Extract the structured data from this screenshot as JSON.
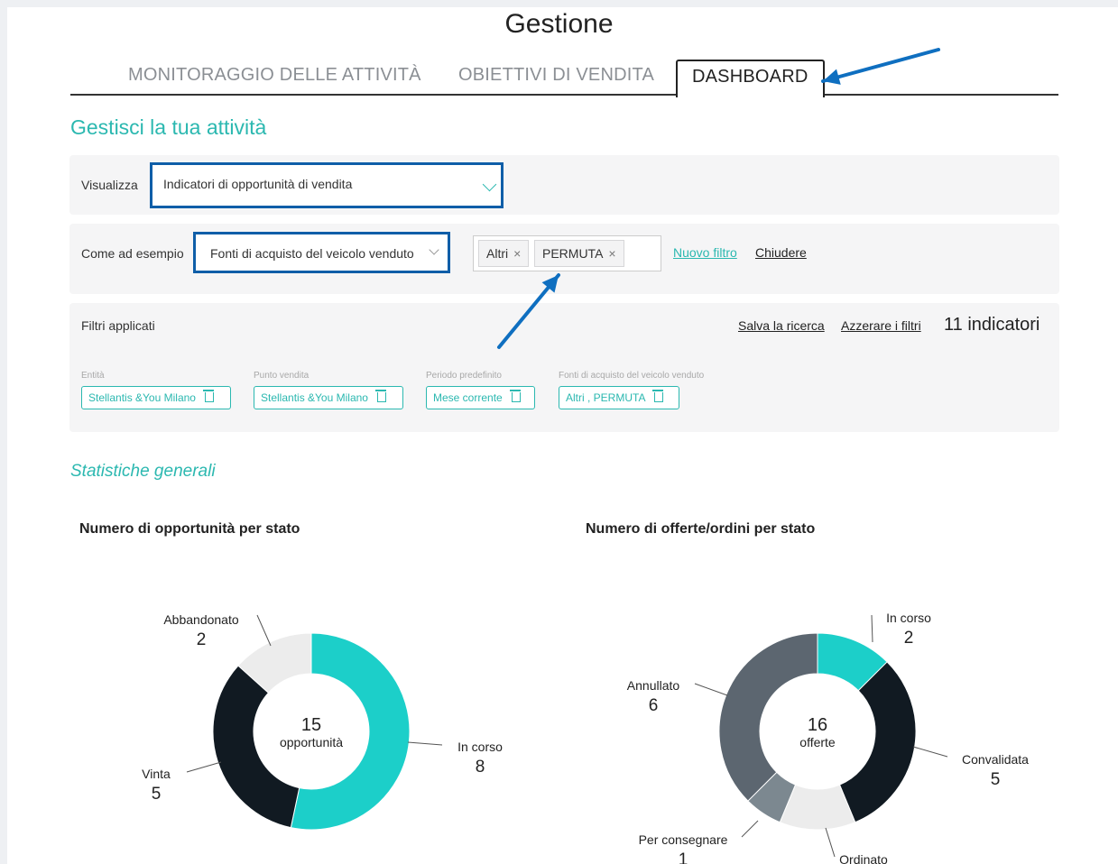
{
  "header": {
    "title": "Gestione"
  },
  "tabs": [
    {
      "label": "MONITORAGGIO DELLE ATTIVITÀ",
      "active": false
    },
    {
      "label": "OBIETTIVI DI VENDITA",
      "active": false
    },
    {
      "label": "DASHBOARD",
      "active": true
    }
  ],
  "section_title": "Gestisci la tua attività",
  "view": {
    "label": "Visualizza",
    "selected": "Indicatori di opportunità di vendita"
  },
  "filter": {
    "label": "Come ad esempio",
    "selected": "Fonti di acquisto del veicolo venduto",
    "chips": [
      "Altri",
      "PERMUTA"
    ],
    "chip_remove": "×",
    "new_filter": "Nuovo filtro",
    "close": "Chiudere"
  },
  "applied": {
    "label": "Filtri applicati",
    "save": "Salva la ricerca",
    "reset": "Azzerare i filtri",
    "count": "11 indicatori",
    "filters": [
      {
        "name": "Entità",
        "value": "Stellantis &You Milano"
      },
      {
        "name": "Punto vendita",
        "value": "Stellantis &You Milano"
      },
      {
        "name": "Periodo predefinito",
        "value": "Mese corrente"
      },
      {
        "name": "Fonti di acquisto del veicolo venduto",
        "value": "Altri , PERMUTA"
      }
    ]
  },
  "stats_title": "Statistiche generali",
  "chart_data": [
    {
      "type": "pie",
      "title": "Numero di opportunità per stato",
      "center_value": "15",
      "center_label": "opportunità",
      "categories": [
        "In corso",
        "Vinta",
        "Abbandonato"
      ],
      "values": [
        8,
        5,
        2
      ],
      "colors": [
        "#1ccfc9",
        "#111a22",
        "#ececec"
      ]
    },
    {
      "type": "pie",
      "title": "Numero di offerte/ordini per stato",
      "center_value": "16",
      "center_label": "offerte",
      "categories": [
        "In corso",
        "Convalidata",
        "Ordinato",
        "Per consegnare",
        "Annullato"
      ],
      "values": [
        2,
        5,
        2,
        1,
        6
      ],
      "colors": [
        "#1ccfc9",
        "#111a22",
        "#ececec",
        "#7c8890",
        "#5c6670"
      ]
    }
  ],
  "annotation_color": "#0f6fc0"
}
